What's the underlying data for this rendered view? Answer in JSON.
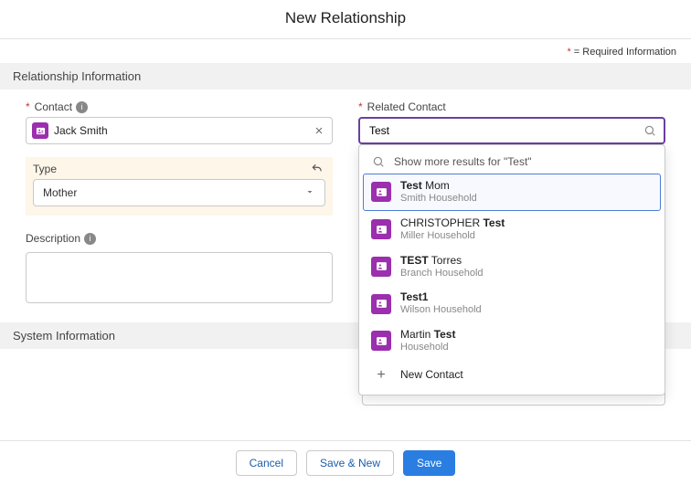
{
  "header": {
    "title": "New Relationship"
  },
  "required_note": {
    "mark": "*",
    "text": " = Required Information"
  },
  "sections": {
    "rel_info": {
      "title": "Relationship Information"
    },
    "sys_info": {
      "title": "System Information"
    }
  },
  "contact": {
    "label": "Contact",
    "value": "Jack Smith"
  },
  "related": {
    "label": "Related Contact",
    "search_value": "Test",
    "show_more": "Show more results for \"Test\"",
    "results": [
      {
        "name_pre": "",
        "name_bold": "Test",
        "name_post": " Mom",
        "sub": "Smith Household"
      },
      {
        "name_pre": "CHRISTOPHER ",
        "name_bold": "Test",
        "name_post": "",
        "sub": "Miller Household"
      },
      {
        "name_pre": "",
        "name_bold": "TEST",
        "name_post": "      Torres",
        "sub": "Branch Household"
      },
      {
        "name_pre": "",
        "name_bold": "Test1",
        "name_post": "",
        "sub": "Wilson Household"
      },
      {
        "name_pre": "Martin ",
        "name_bold": "Test",
        "name_post": "",
        "sub": "Household"
      }
    ],
    "new_label": "New Contact"
  },
  "type": {
    "label": "Type",
    "value": "Mother"
  },
  "description": {
    "label": "Description",
    "value": ""
  },
  "buttons": {
    "cancel": "Cancel",
    "save_new": "Save & New",
    "save": "Save"
  }
}
